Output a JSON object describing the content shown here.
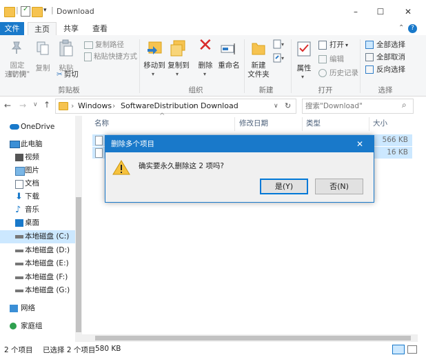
{
  "window": {
    "title": "Download",
    "minimize": "–",
    "maximize": "☐",
    "close": "✕"
  },
  "tabs": {
    "file": "文件",
    "home": "主页",
    "share": "共享",
    "view": "查看"
  },
  "ribbon": {
    "clipboard": {
      "pin_label_1": "固定到\"快",
      "pin_label_2": "速访问\"",
      "copy": "复制",
      "paste": "粘贴",
      "copy_path": "复制路径",
      "paste_shortcut": "粘贴快捷方式",
      "cut": "剪切",
      "group": "剪贴板"
    },
    "organize": {
      "move_to": "移动到",
      "copy_to": "复制到",
      "delete": "删除",
      "rename": "重命名",
      "group": "组织"
    },
    "new": {
      "new_folder_1": "新建",
      "new_folder_2": "文件夹",
      "group": "新建"
    },
    "open": {
      "properties": "属性",
      "open": "打开",
      "edit": "编辑",
      "history": "历史记录",
      "group": "打开"
    },
    "select": {
      "select_all": "全部选择",
      "select_none": "全部取消",
      "invert": "反向选择",
      "group": "选择"
    }
  },
  "address": {
    "crumbs": [
      "Windows",
      "SoftwareDistribution",
      "Download"
    ],
    "search_placeholder": "搜索\"Download\""
  },
  "nav": {
    "onedrive": "OneDrive",
    "this_pc": "此电脑",
    "videos": "视频",
    "pictures": "图片",
    "documents": "文档",
    "downloads": "下载",
    "music": "音乐",
    "desktop": "桌面",
    "drive_c": "本地磁盘 (C:)",
    "drive_d": "本地磁盘 (D:)",
    "drive_e": "本地磁盘 (E:)",
    "drive_f": "本地磁盘 (F:)",
    "drive_g": "本地磁盘 (G:)",
    "network": "网络",
    "homegroup": "家庭组"
  },
  "columns": {
    "name": "名称",
    "modified": "修改日期",
    "type": "类型",
    "size": "大小"
  },
  "files": [
    {
      "size": "566 KB"
    },
    {
      "size": "16 KB"
    }
  ],
  "status": {
    "count": "2 个项目",
    "selected": "已选择 2 个项目",
    "size": "580 KB"
  },
  "dialog": {
    "title": "删除多个项目",
    "message": "确实要永久删除这 2 项吗?",
    "yes": "是(Y)",
    "no": "否(N)",
    "close": "✕"
  },
  "colors": {
    "accent": "#1979ca",
    "selection": "#cce8ff",
    "ribbon_bg": "#f5f6f7"
  }
}
